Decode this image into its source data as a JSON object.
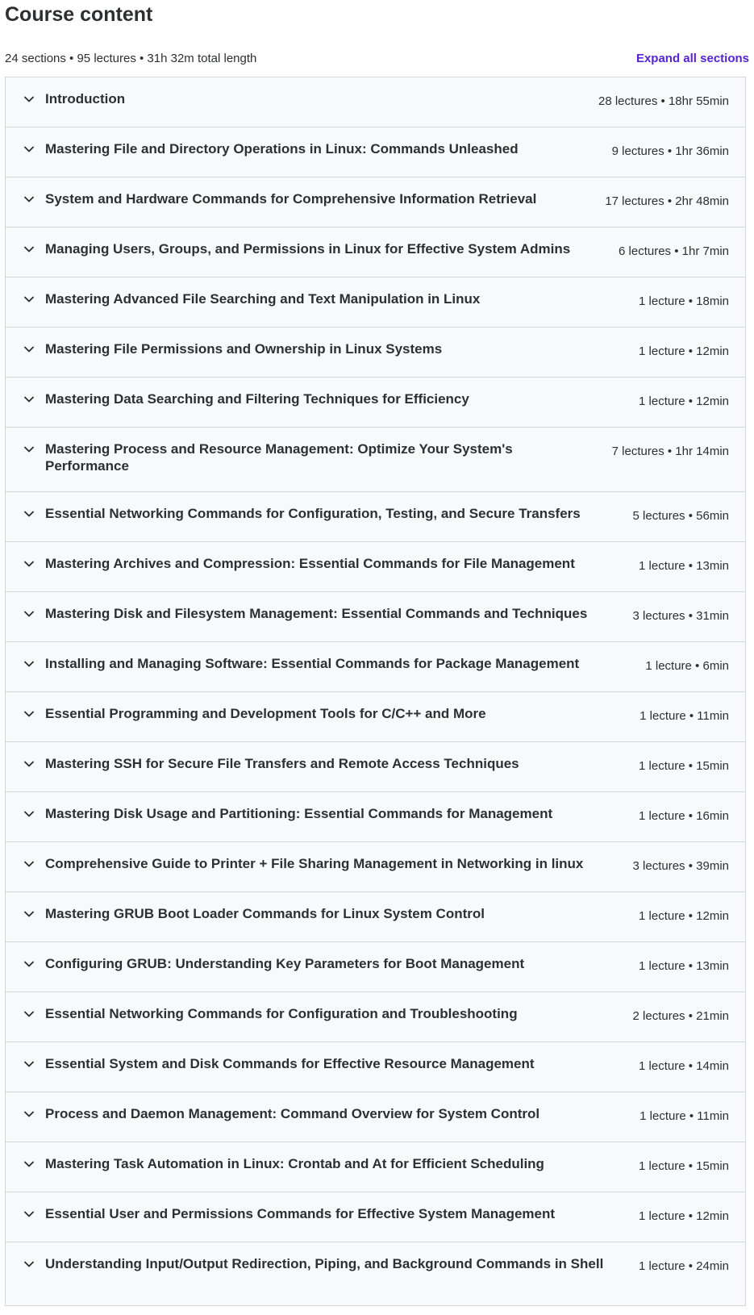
{
  "header": {
    "title": "Course content",
    "summary": "24 sections • 95 lectures • 31h 32m total length",
    "expand_all_label": "Expand all sections"
  },
  "colors": {
    "accent": "#5624d0",
    "section_bg": "#f7f9fa",
    "border": "#d1d7dc",
    "text": "#2d2f31"
  },
  "icons": {
    "section_toggle": "chevron-down-icon"
  },
  "sections": [
    {
      "title": "Introduction",
      "meta": "28 lectures • 18hr 55min"
    },
    {
      "title": "Mastering File and Directory Operations in Linux: Commands Unleashed",
      "meta": "9 lectures • 1hr 36min"
    },
    {
      "title": "System and Hardware Commands for Comprehensive Information Retrieval",
      "meta": "17 lectures • 2hr 48min"
    },
    {
      "title": "Managing Users, Groups, and Permissions in Linux for Effective System Admins",
      "meta": "6 lectures • 1hr 7min"
    },
    {
      "title": "Mastering Advanced File Searching and Text Manipulation in Linux",
      "meta": "1 lecture • 18min"
    },
    {
      "title": "Mastering File Permissions and Ownership in Linux Systems",
      "meta": "1 lecture • 12min"
    },
    {
      "title": "Mastering Data Searching and Filtering Techniques for Efficiency",
      "meta": "1 lecture • 12min"
    },
    {
      "title": "Mastering Process and Resource Management: Optimize Your System's Performance",
      "meta": "7 lectures • 1hr 14min"
    },
    {
      "title": "Essential Networking Commands for Configuration, Testing, and Secure Transfers",
      "meta": "5 lectures • 56min"
    },
    {
      "title": "Mastering Archives and Compression: Essential Commands for File Management",
      "meta": "1 lecture • 13min"
    },
    {
      "title": "Mastering Disk and Filesystem Management: Essential Commands and Techniques",
      "meta": "3 lectures • 31min"
    },
    {
      "title": "Installing and Managing Software: Essential Commands for Package Management",
      "meta": "1 lecture • 6min"
    },
    {
      "title": "Essential Programming and Development Tools for C/C++ and More",
      "meta": "1 lecture • 11min"
    },
    {
      "title": "Mastering SSH for Secure File Transfers and Remote Access Techniques",
      "meta": "1 lecture • 15min"
    },
    {
      "title": "Mastering Disk Usage and Partitioning: Essential Commands for Management",
      "meta": "1 lecture • 16min"
    },
    {
      "title": "Comprehensive Guide to Printer + File Sharing Management in Networking in linux",
      "meta": "3 lectures • 39min"
    },
    {
      "title": "Mastering GRUB Boot Loader Commands for Linux System Control",
      "meta": "1 lecture • 12min"
    },
    {
      "title": "Configuring GRUB: Understanding Key Parameters for Boot Management",
      "meta": "1 lecture • 13min"
    },
    {
      "title": "Essential Networking Commands for Configuration and Troubleshooting",
      "meta": "2 lectures • 21min"
    },
    {
      "title": "Essential System and Disk Commands for Effective Resource Management",
      "meta": "1 lecture • 14min"
    },
    {
      "title": "Process and Daemon Management: Command Overview for System Control",
      "meta": "1 lecture • 11min"
    },
    {
      "title": "Mastering Task Automation in Linux: Crontab and At for Efficient Scheduling",
      "meta": "1 lecture • 15min"
    },
    {
      "title": "Essential User and Permissions Commands for Effective System Management",
      "meta": "1 lecture • 12min"
    },
    {
      "title": "Understanding Input/Output Redirection, Piping, and Background Commands in Shell",
      "meta": "1 lecture • 24min"
    }
  ]
}
